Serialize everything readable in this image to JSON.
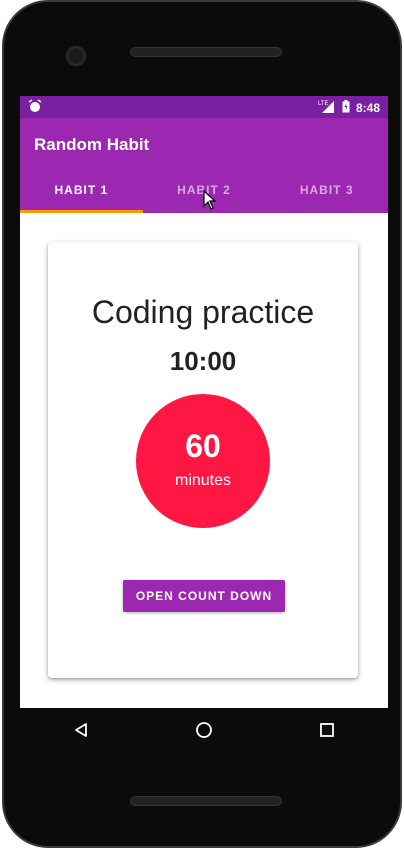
{
  "status": {
    "time": "8:48",
    "network": "LTE"
  },
  "app": {
    "title": "Random Habit"
  },
  "tabs": [
    {
      "label": "HABIT 1",
      "active": true
    },
    {
      "label": "HABIT 2",
      "active": false
    },
    {
      "label": "HABIT 3",
      "active": false
    }
  ],
  "card": {
    "habit_name": "Coding practice",
    "timer": "10:00",
    "duration_value": "60",
    "duration_unit": "minutes",
    "button_label": "OPEN COUNT DOWN"
  },
  "colors": {
    "primary": "#9c27b0",
    "primary_dark": "#7b1fa2",
    "accent": "#ff1744",
    "tab_indicator": "#ff9800"
  }
}
